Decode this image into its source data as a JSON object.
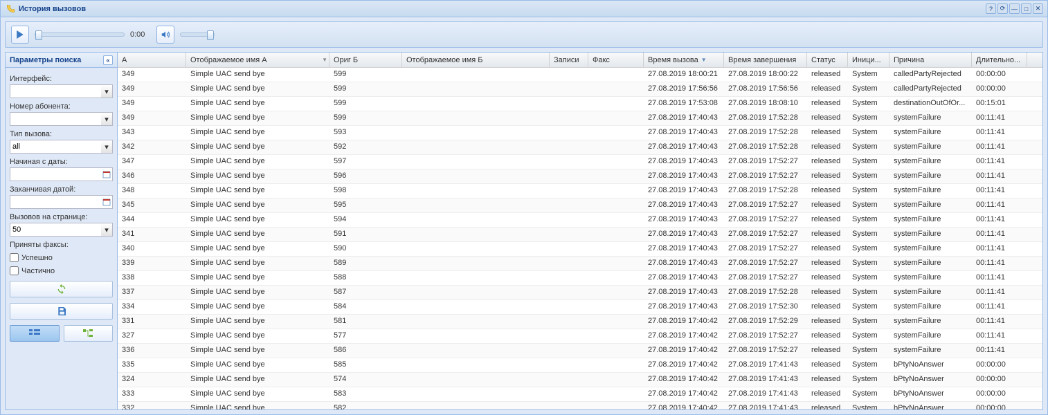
{
  "window": {
    "title": "История вызовов"
  },
  "toolbar": {
    "time": "0:00"
  },
  "sidebar": {
    "title": "Параметры поиска",
    "labels": {
      "interface": "Интерфейс:",
      "subscriber": "Номер абонента:",
      "calltype": "Тип вызова:",
      "from": "Начиная с даты:",
      "to": "Заканчивая датой:",
      "perpage": "Вызовов на странице:",
      "faxes": "Приняты факсы:",
      "success": "Успешно",
      "partial": "Частично"
    },
    "values": {
      "interface": "",
      "subscriber": "",
      "calltype": "all",
      "from": "",
      "to": "",
      "perpage": "50"
    }
  },
  "columns": [
    "А",
    "Отображаемое имя А",
    "Ориг Б",
    "Отображаемое имя Б",
    "Записи",
    "Факс",
    "Время вызова",
    "Время завершения",
    "Статус",
    "Иници...",
    "Причина",
    "Длительно..."
  ],
  "rows": [
    {
      "a": "349",
      "nameA": "Simple UAC send bye",
      "origB": "599",
      "nameB": "",
      "rec": "",
      "fax": "",
      "tcall": "27.08.2019 18:00:21",
      "tend": "27.08.2019 18:00:22",
      "status": "released",
      "init": "System",
      "reason": "calledPartyRejected",
      "dur": "00:00:00"
    },
    {
      "a": "349",
      "nameA": "Simple UAC send bye",
      "origB": "599",
      "nameB": "",
      "rec": "",
      "fax": "",
      "tcall": "27.08.2019 17:56:56",
      "tend": "27.08.2019 17:56:56",
      "status": "released",
      "init": "System",
      "reason": "calledPartyRejected",
      "dur": "00:00:00"
    },
    {
      "a": "349",
      "nameA": "Simple UAC send bye",
      "origB": "599",
      "nameB": "",
      "rec": "",
      "fax": "",
      "tcall": "27.08.2019 17:53:08",
      "tend": "27.08.2019 18:08:10",
      "status": "released",
      "init": "System",
      "reason": "destinationOutOfOr...",
      "dur": "00:15:01"
    },
    {
      "a": "349",
      "nameA": "Simple UAC send bye",
      "origB": "599",
      "nameB": "",
      "rec": "",
      "fax": "",
      "tcall": "27.08.2019 17:40:43",
      "tend": "27.08.2019 17:52:28",
      "status": "released",
      "init": "System",
      "reason": "systemFailure",
      "dur": "00:11:41"
    },
    {
      "a": "343",
      "nameA": "Simple UAC send bye",
      "origB": "593",
      "nameB": "",
      "rec": "",
      "fax": "",
      "tcall": "27.08.2019 17:40:43",
      "tend": "27.08.2019 17:52:28",
      "status": "released",
      "init": "System",
      "reason": "systemFailure",
      "dur": "00:11:41"
    },
    {
      "a": "342",
      "nameA": "Simple UAC send bye",
      "origB": "592",
      "nameB": "",
      "rec": "",
      "fax": "",
      "tcall": "27.08.2019 17:40:43",
      "tend": "27.08.2019 17:52:28",
      "status": "released",
      "init": "System",
      "reason": "systemFailure",
      "dur": "00:11:41"
    },
    {
      "a": "347",
      "nameA": "Simple UAC send bye",
      "origB": "597",
      "nameB": "",
      "rec": "",
      "fax": "",
      "tcall": "27.08.2019 17:40:43",
      "tend": "27.08.2019 17:52:27",
      "status": "released",
      "init": "System",
      "reason": "systemFailure",
      "dur": "00:11:41"
    },
    {
      "a": "346",
      "nameA": "Simple UAC send bye",
      "origB": "596",
      "nameB": "",
      "rec": "",
      "fax": "",
      "tcall": "27.08.2019 17:40:43",
      "tend": "27.08.2019 17:52:27",
      "status": "released",
      "init": "System",
      "reason": "systemFailure",
      "dur": "00:11:41"
    },
    {
      "a": "348",
      "nameA": "Simple UAC send bye",
      "origB": "598",
      "nameB": "",
      "rec": "",
      "fax": "",
      "tcall": "27.08.2019 17:40:43",
      "tend": "27.08.2019 17:52:28",
      "status": "released",
      "init": "System",
      "reason": "systemFailure",
      "dur": "00:11:41"
    },
    {
      "a": "345",
      "nameA": "Simple UAC send bye",
      "origB": "595",
      "nameB": "",
      "rec": "",
      "fax": "",
      "tcall": "27.08.2019 17:40:43",
      "tend": "27.08.2019 17:52:27",
      "status": "released",
      "init": "System",
      "reason": "systemFailure",
      "dur": "00:11:41"
    },
    {
      "a": "344",
      "nameA": "Simple UAC send bye",
      "origB": "594",
      "nameB": "",
      "rec": "",
      "fax": "",
      "tcall": "27.08.2019 17:40:43",
      "tend": "27.08.2019 17:52:27",
      "status": "released",
      "init": "System",
      "reason": "systemFailure",
      "dur": "00:11:41"
    },
    {
      "a": "341",
      "nameA": "Simple UAC send bye",
      "origB": "591",
      "nameB": "",
      "rec": "",
      "fax": "",
      "tcall": "27.08.2019 17:40:43",
      "tend": "27.08.2019 17:52:27",
      "status": "released",
      "init": "System",
      "reason": "systemFailure",
      "dur": "00:11:41"
    },
    {
      "a": "340",
      "nameA": "Simple UAC send bye",
      "origB": "590",
      "nameB": "",
      "rec": "",
      "fax": "",
      "tcall": "27.08.2019 17:40:43",
      "tend": "27.08.2019 17:52:27",
      "status": "released",
      "init": "System",
      "reason": "systemFailure",
      "dur": "00:11:41"
    },
    {
      "a": "339",
      "nameA": "Simple UAC send bye",
      "origB": "589",
      "nameB": "",
      "rec": "",
      "fax": "",
      "tcall": "27.08.2019 17:40:43",
      "tend": "27.08.2019 17:52:27",
      "status": "released",
      "init": "System",
      "reason": "systemFailure",
      "dur": "00:11:41"
    },
    {
      "a": "338",
      "nameA": "Simple UAC send bye",
      "origB": "588",
      "nameB": "",
      "rec": "",
      "fax": "",
      "tcall": "27.08.2019 17:40:43",
      "tend": "27.08.2019 17:52:27",
      "status": "released",
      "init": "System",
      "reason": "systemFailure",
      "dur": "00:11:41"
    },
    {
      "a": "337",
      "nameA": "Simple UAC send bye",
      "origB": "587",
      "nameB": "",
      "rec": "",
      "fax": "",
      "tcall": "27.08.2019 17:40:43",
      "tend": "27.08.2019 17:52:28",
      "status": "released",
      "init": "System",
      "reason": "systemFailure",
      "dur": "00:11:41"
    },
    {
      "a": "334",
      "nameA": "Simple UAC send bye",
      "origB": "584",
      "nameB": "",
      "rec": "",
      "fax": "",
      "tcall": "27.08.2019 17:40:43",
      "tend": "27.08.2019 17:52:30",
      "status": "released",
      "init": "System",
      "reason": "systemFailure",
      "dur": "00:11:41"
    },
    {
      "a": "331",
      "nameA": "Simple UAC send bye",
      "origB": "581",
      "nameB": "",
      "rec": "",
      "fax": "",
      "tcall": "27.08.2019 17:40:42",
      "tend": "27.08.2019 17:52:29",
      "status": "released",
      "init": "System",
      "reason": "systemFailure",
      "dur": "00:11:41"
    },
    {
      "a": "327",
      "nameA": "Simple UAC send bye",
      "origB": "577",
      "nameB": "",
      "rec": "",
      "fax": "",
      "tcall": "27.08.2019 17:40:42",
      "tend": "27.08.2019 17:52:27",
      "status": "released",
      "init": "System",
      "reason": "systemFailure",
      "dur": "00:11:41"
    },
    {
      "a": "336",
      "nameA": "Simple UAC send bye",
      "origB": "586",
      "nameB": "",
      "rec": "",
      "fax": "",
      "tcall": "27.08.2019 17:40:42",
      "tend": "27.08.2019 17:52:27",
      "status": "released",
      "init": "System",
      "reason": "systemFailure",
      "dur": "00:11:41"
    },
    {
      "a": "335",
      "nameA": "Simple UAC send bye",
      "origB": "585",
      "nameB": "",
      "rec": "",
      "fax": "",
      "tcall": "27.08.2019 17:40:42",
      "tend": "27.08.2019 17:41:43",
      "status": "released",
      "init": "System",
      "reason": "bPtyNoAnswer",
      "dur": "00:00:00"
    },
    {
      "a": "324",
      "nameA": "Simple UAC send bye",
      "origB": "574",
      "nameB": "",
      "rec": "",
      "fax": "",
      "tcall": "27.08.2019 17:40:42",
      "tend": "27.08.2019 17:41:43",
      "status": "released",
      "init": "System",
      "reason": "bPtyNoAnswer",
      "dur": "00:00:00"
    },
    {
      "a": "333",
      "nameA": "Simple UAC send bye",
      "origB": "583",
      "nameB": "",
      "rec": "",
      "fax": "",
      "tcall": "27.08.2019 17:40:42",
      "tend": "27.08.2019 17:41:43",
      "status": "released",
      "init": "System",
      "reason": "bPtyNoAnswer",
      "dur": "00:00:00"
    },
    {
      "a": "332",
      "nameA": "Simple UAC send bye",
      "origB": "582",
      "nameB": "",
      "rec": "",
      "fax": "",
      "tcall": "27.08.2019 17:40:42",
      "tend": "27.08.2019 17:41:43",
      "status": "released",
      "init": "System",
      "reason": "bPtyNoAnswer",
      "dur": "00:00:00"
    }
  ]
}
